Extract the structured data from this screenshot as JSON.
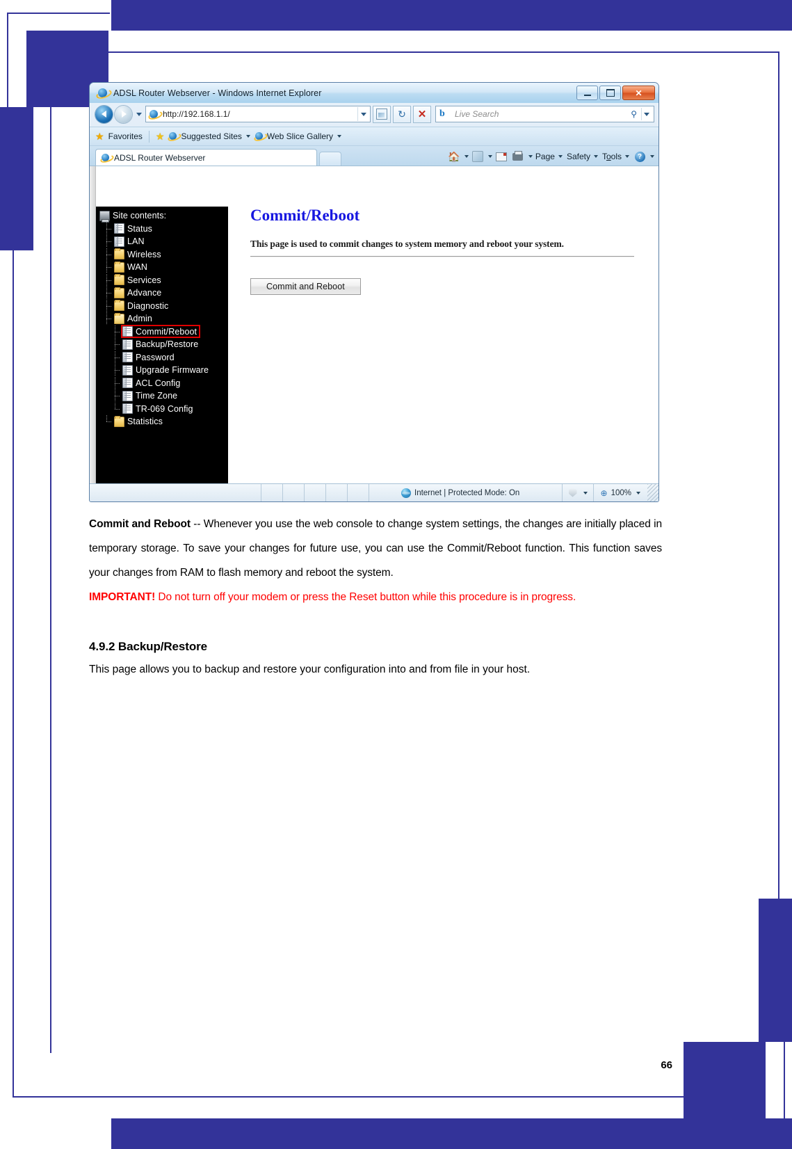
{
  "document": {
    "page_number": "66",
    "paragraph_lead_bold": "Commit and Reboot",
    "paragraph_rest": " -- Whenever you use the web console to change system settings, the changes are initially placed in temporary storage. To save your changes for future use, you can use the Commit/Reboot function. This function saves your changes from RAM to flash memory and reboot the system.",
    "important_label": "IMPORTANT!",
    "important_text": " Do not turn off your modem or press the Reset button while this procedure is in progress.",
    "section_heading": "4.9.2 Backup/Restore",
    "section_body": "This page allows you to backup and restore your configuration into and from file in your host."
  },
  "browser": {
    "window_title": "ADSL Router Webserver - Windows Internet Explorer",
    "window_buttons": {
      "minimize": "–",
      "maximize": "□",
      "close": "✕"
    },
    "address": {
      "protocol_prefix": "http://",
      "host": "192.168.1.1",
      "path": "/",
      "full": "http://192.168.1.1/"
    },
    "nav": {
      "back_title": "Back",
      "forward_title": "Forward",
      "history_caret": "▾"
    },
    "toolbar_buttons": [
      {
        "name": "compatibility-view",
        "glyph": "⎘"
      },
      {
        "name": "refresh",
        "glyph": "↻"
      },
      {
        "name": "stop",
        "glyph": "✕"
      }
    ],
    "search": {
      "provider_glyph": "b",
      "placeholder": "Live Search",
      "icon": "⚲",
      "caret": "▾"
    },
    "favorites_bar": {
      "favorites_label": "Favorites",
      "items": [
        {
          "label": "Suggested Sites",
          "caret": "▾"
        },
        {
          "label": "Web Slice Gallery",
          "caret": "▾"
        }
      ]
    },
    "tab": {
      "label": "ADSL Router Webserver"
    },
    "command_bar": {
      "home_caret": "▾",
      "feeds_caret": "▾",
      "print_caret": "▾",
      "page": "Page",
      "page_caret": "▾",
      "safety": "Safety",
      "safety_caret": "▾",
      "tools_pre": "T",
      "tools_u": "o",
      "tools_post": "ols",
      "tools_caret": "▾",
      "help_glyph": "?",
      "help_caret": "▾"
    },
    "status_bar": {
      "zone_text": "Internet | Protected Mode: On",
      "zoom_level": "100%",
      "zoom_glyph": "⊕",
      "protected_caret": "▾",
      "zoom_caret": "▾"
    }
  },
  "router_page": {
    "sidebar": {
      "root_label": "Site contents:",
      "items": [
        {
          "label": "Status",
          "icon": "page-icon",
          "indent": 1,
          "selected": false
        },
        {
          "label": "LAN",
          "icon": "page-icon",
          "indent": 1,
          "selected": false
        },
        {
          "label": "Wireless",
          "icon": "folder-icon",
          "indent": 1,
          "selected": false
        },
        {
          "label": "WAN",
          "icon": "folder-icon",
          "indent": 1,
          "selected": false
        },
        {
          "label": "Services",
          "icon": "folder-icon",
          "indent": 1,
          "selected": false
        },
        {
          "label": "Advance",
          "icon": "folder-icon",
          "indent": 1,
          "selected": false
        },
        {
          "label": "Diagnostic",
          "icon": "folder-icon",
          "indent": 1,
          "selected": false
        },
        {
          "label": "Admin",
          "icon": "folder-open-icon",
          "indent": 1,
          "selected": false
        },
        {
          "label": "Commit/Reboot",
          "icon": "page-icon",
          "indent": 2,
          "selected": true
        },
        {
          "label": "Backup/Restore",
          "icon": "page-icon",
          "indent": 2,
          "selected": false
        },
        {
          "label": "Password",
          "icon": "page-icon",
          "indent": 2,
          "selected": false
        },
        {
          "label": "Upgrade Firmware",
          "icon": "page-icon",
          "indent": 2,
          "selected": false
        },
        {
          "label": "ACL Config",
          "icon": "page-icon",
          "indent": 2,
          "selected": false
        },
        {
          "label": "Time Zone",
          "icon": "page-icon",
          "indent": 2,
          "selected": false
        },
        {
          "label": "TR-069 Config",
          "icon": "page-icon",
          "indent": 2,
          "selected": false
        },
        {
          "label": "Statistics",
          "icon": "folder-icon",
          "indent": 1,
          "selected": false
        }
      ]
    },
    "main": {
      "title": "Commit/Reboot",
      "description": "This page is used to commit changes to system memory and reboot your system.",
      "button_label": "Commit and Reboot"
    }
  },
  "colors": {
    "page_border": "#333399",
    "router_title": "#1717e0",
    "warning_red": "#ff0000",
    "selection_outline": "#e00000",
    "sidebar_bg": "#000000"
  }
}
